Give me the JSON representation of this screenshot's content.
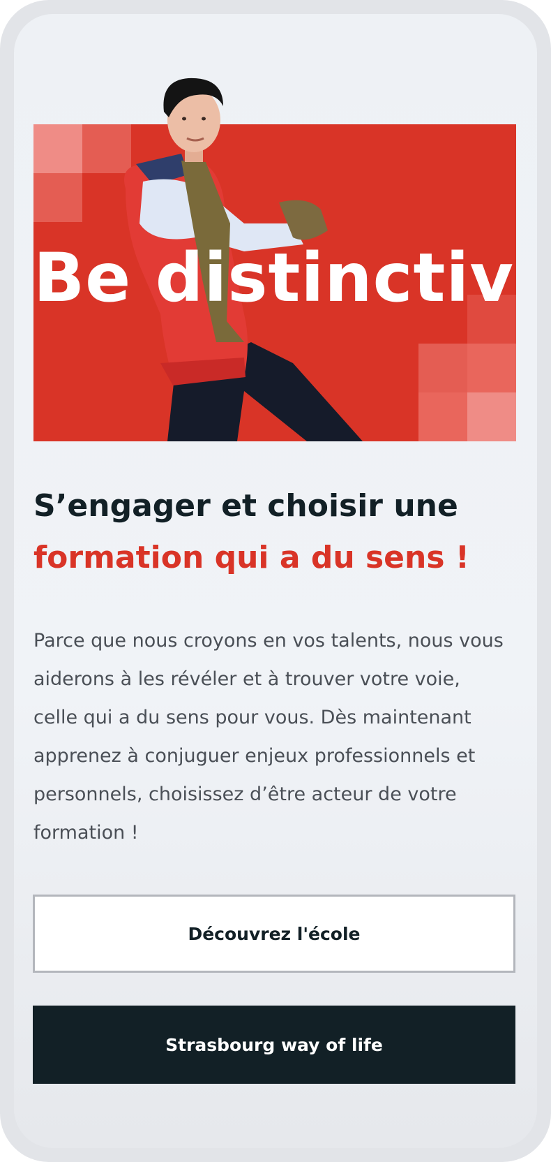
{
  "hero": {
    "title": "Be distinctive",
    "accent_color": "#d93427"
  },
  "headline": {
    "line1": "S’engager et choisir une",
    "line2": "formation qui a du sens !"
  },
  "intro": {
    "text": "Parce que nous croyons en vos talents, nous vous aiderons à les révéler et à trouver votre voie, celle qui a du sens pour vous. Dès maintenant apprenez à conjuguer enjeux professionnels et personnels, choisissez d’être acteur de votre formation !"
  },
  "buttons": {
    "discover_label": "Découvrez l'école",
    "strasbourg_label": "Strasbourg way of life"
  },
  "colors": {
    "dark": "#122026",
    "page_bg": "#eef1f5"
  }
}
